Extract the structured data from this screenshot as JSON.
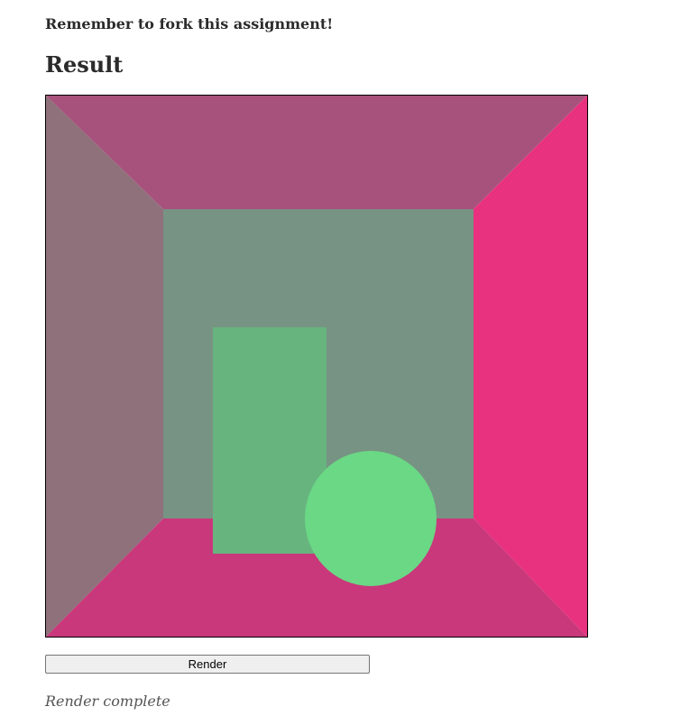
{
  "page": {
    "reminder": "Remember to fork this assignment!",
    "heading": "Result"
  },
  "render": {
    "button_label": "Render",
    "status": "Render complete"
  },
  "scene": {
    "left_wall_color": "#8e717b",
    "right_wall_color": "#e8317f",
    "top_wall_color": "#a7527c",
    "floor_color": "#c9387b",
    "back_wall_color": "#779383",
    "box_color": "#67b47f",
    "sphere_color": "#6ad885",
    "border_color": "#000000"
  }
}
